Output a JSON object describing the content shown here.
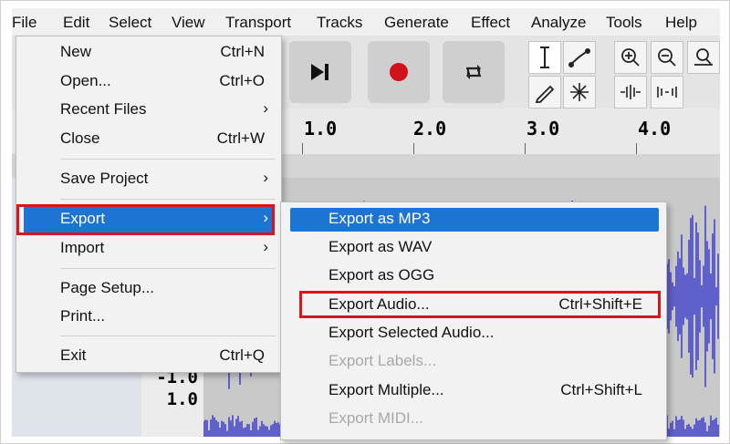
{
  "menubar": {
    "items": [
      {
        "label": "File",
        "ul": "F"
      },
      {
        "label": "Edit",
        "ul": "E"
      },
      {
        "label": "Select",
        "ul": "S"
      },
      {
        "label": "View",
        "ul": "V"
      },
      {
        "label": "Transport",
        "ul": "r"
      },
      {
        "label": "Tracks",
        "ul": "T"
      },
      {
        "label": "Generate",
        "ul": "G"
      },
      {
        "label": "Effect",
        "ul": "c"
      },
      {
        "label": "Analyze",
        "ul": "A"
      },
      {
        "label": "Tools",
        "ul": "o"
      },
      {
        "label": "Help",
        "ul": "H"
      }
    ]
  },
  "file_menu": {
    "new": {
      "label": "New",
      "shortcut": "Ctrl+N"
    },
    "open": {
      "label": "Open...",
      "shortcut": "Ctrl+O"
    },
    "recent": {
      "label": "Recent Files",
      "arrow": "›"
    },
    "close": {
      "label": "Close",
      "shortcut": "Ctrl+W"
    },
    "save_project": {
      "label": "Save Project",
      "arrow": "›"
    },
    "export": {
      "label": "Export",
      "arrow": "›"
    },
    "import": {
      "label": "Import",
      "arrow": "›"
    },
    "page_setup": {
      "label": "Page Setup..."
    },
    "print": {
      "label": "Print..."
    },
    "exit": {
      "label": "Exit",
      "shortcut": "Ctrl+Q"
    }
  },
  "export_submenu": {
    "mp3": {
      "label": "Export as MP3"
    },
    "wav": {
      "label": "Export as WAV"
    },
    "ogg": {
      "label": "Export as OGG"
    },
    "audio": {
      "label": "Export Audio...",
      "shortcut": "Ctrl+Shift+E"
    },
    "selected": {
      "label": "Export Selected Audio..."
    },
    "labels": {
      "label": "Export Labels..."
    },
    "multiple": {
      "label": "Export Multiple...",
      "shortcut": "Ctrl+Shift+L"
    },
    "midi": {
      "label": "Export MIDI..."
    }
  },
  "ruler": {
    "ticks": [
      "1.0",
      "2.0",
      "3.0",
      "4.0"
    ]
  },
  "track": {
    "scale_labels": [
      "-1.0",
      "1.0"
    ]
  },
  "colors": {
    "selection": "#1e74d2",
    "highlight": "#d9141b",
    "waveform": "#3333cc",
    "record": "#d0121b"
  },
  "icons": [
    "skip-to-end-icon",
    "record-icon",
    "loop-icon",
    "selection-tool-icon",
    "envelope-tool-icon",
    "draw-tool-icon",
    "multi-tool-icon",
    "zoom-in-icon",
    "zoom-out-icon",
    "zoom-fit-icon",
    "trim-outside-icon",
    "silence-selection-icon"
  ]
}
